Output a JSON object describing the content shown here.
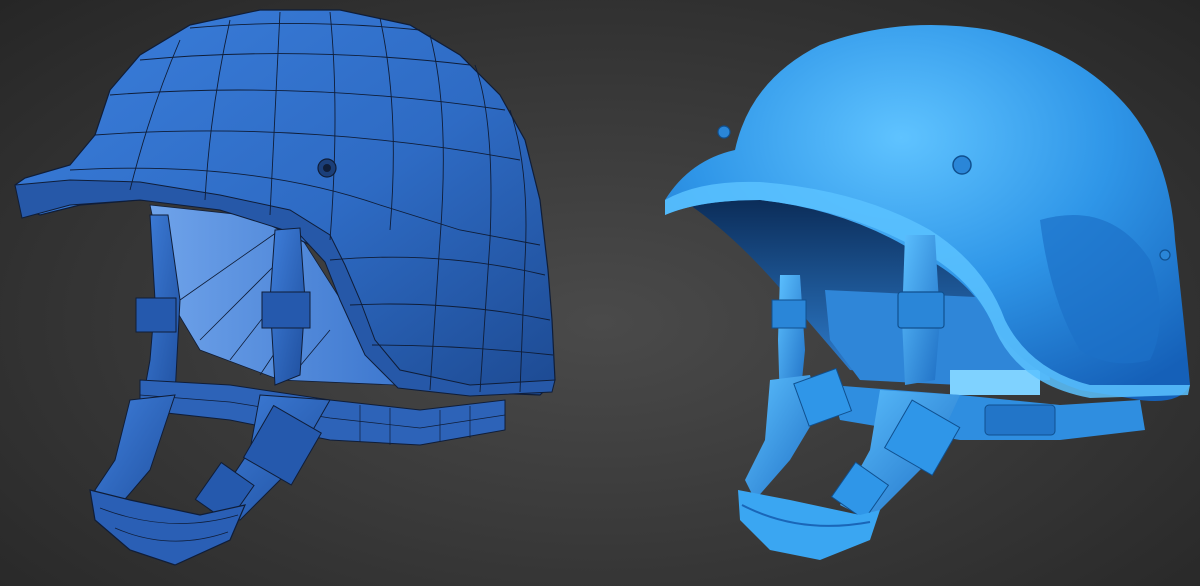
{
  "scene": {
    "background_color": "#3a3a3a",
    "models": [
      {
        "id": "wireframe-helmet",
        "shading": "wireframe",
        "color": "#2f6fcf",
        "wire_color": "#0f1d38"
      },
      {
        "id": "smooth-helmet",
        "shading": "smooth",
        "color": "#3aa0ee"
      }
    ]
  }
}
